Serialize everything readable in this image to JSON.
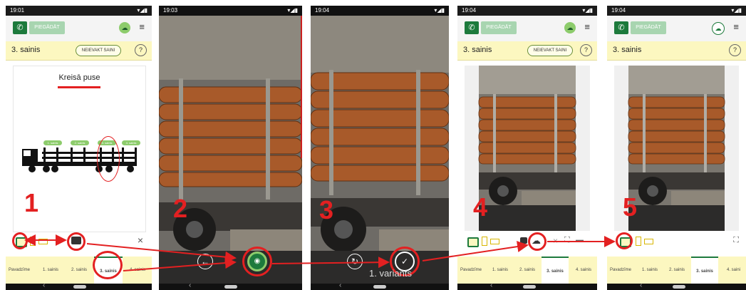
{
  "status": {
    "p1_time": "19:01",
    "p2_time": "19:03",
    "p3_time": "19:04",
    "p4_time": "19:04",
    "p5_time": "19:04",
    "icons": "▾◢▮"
  },
  "header": {
    "call_icon": "phone-icon",
    "pieg_label": "PIEGĀDĀT",
    "cloud_icon": "cloud-icon",
    "menu_icon": "menu-icon"
  },
  "subheader": {
    "title": "3. sainis",
    "neievakt_label": "NEIEVAKT SAINI",
    "help_label": "?"
  },
  "panel1": {
    "side_label": "Kreisā puse",
    "close_label": "×",
    "badges": [
      "1. sainis",
      "2. sainis",
      "3. sainis",
      "4. sainis"
    ]
  },
  "tabs": [
    "Pavadzīme",
    "1. sainis",
    "2. sainis",
    "3. sainis",
    "4. sainis"
  ],
  "tabs_p5_last": "4. saini",
  "variant_label": "1. variants",
  "steps": [
    "1",
    "2",
    "3",
    "4",
    "5"
  ],
  "colors": {
    "accent_green": "#1d7a3c",
    "annotation_red": "#e32021",
    "yellow_bar": "#fcf7c0"
  }
}
